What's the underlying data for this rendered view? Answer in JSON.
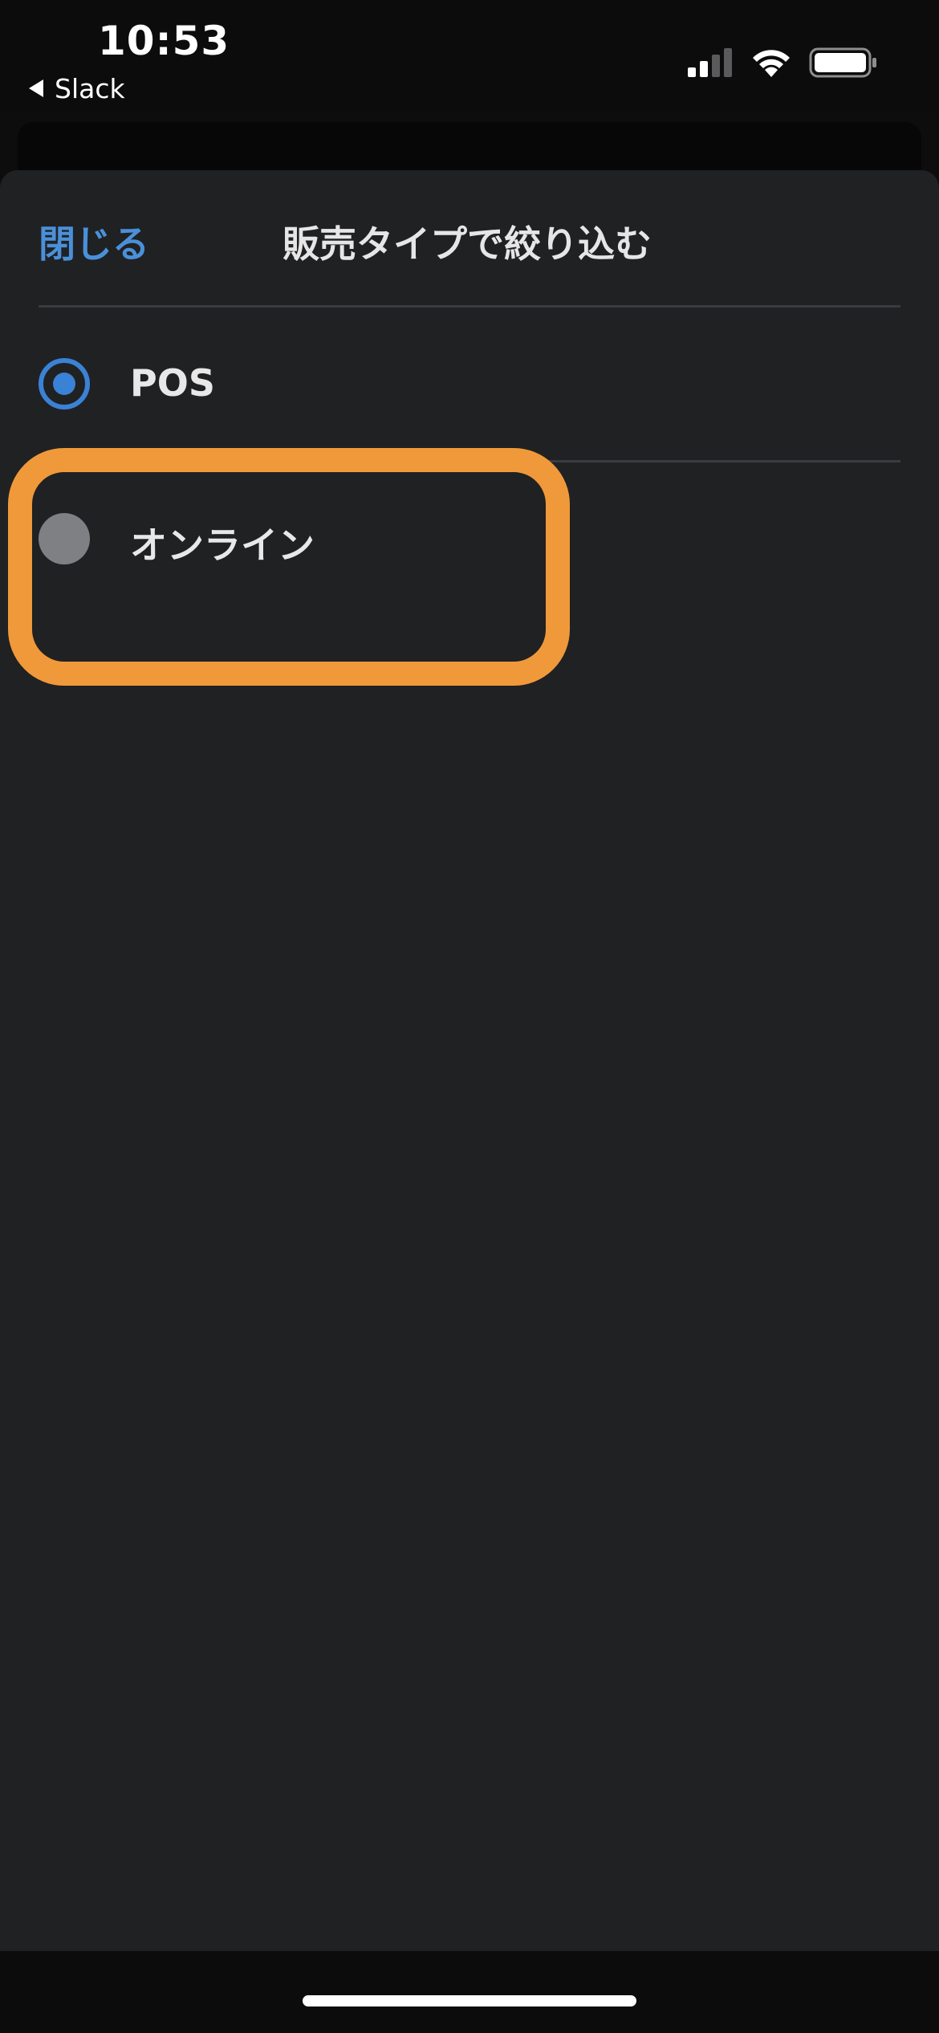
{
  "status_bar": {
    "time": "10:53",
    "back_app_label": "Slack",
    "icons": [
      "cellular-signal-icon",
      "wifi-icon",
      "battery-icon"
    ]
  },
  "sheet": {
    "close_label": "閉じる",
    "title": "販売タイプで絞り込む",
    "options": [
      {
        "label": "POS",
        "selected": true
      },
      {
        "label": "オンライン",
        "selected": false
      }
    ]
  },
  "colors": {
    "accent": "#3a82d6",
    "close_link": "#4a90d9",
    "highlight": "#f0993a",
    "sheet_background": "#202123",
    "unselected_radio": "#7f8083"
  }
}
